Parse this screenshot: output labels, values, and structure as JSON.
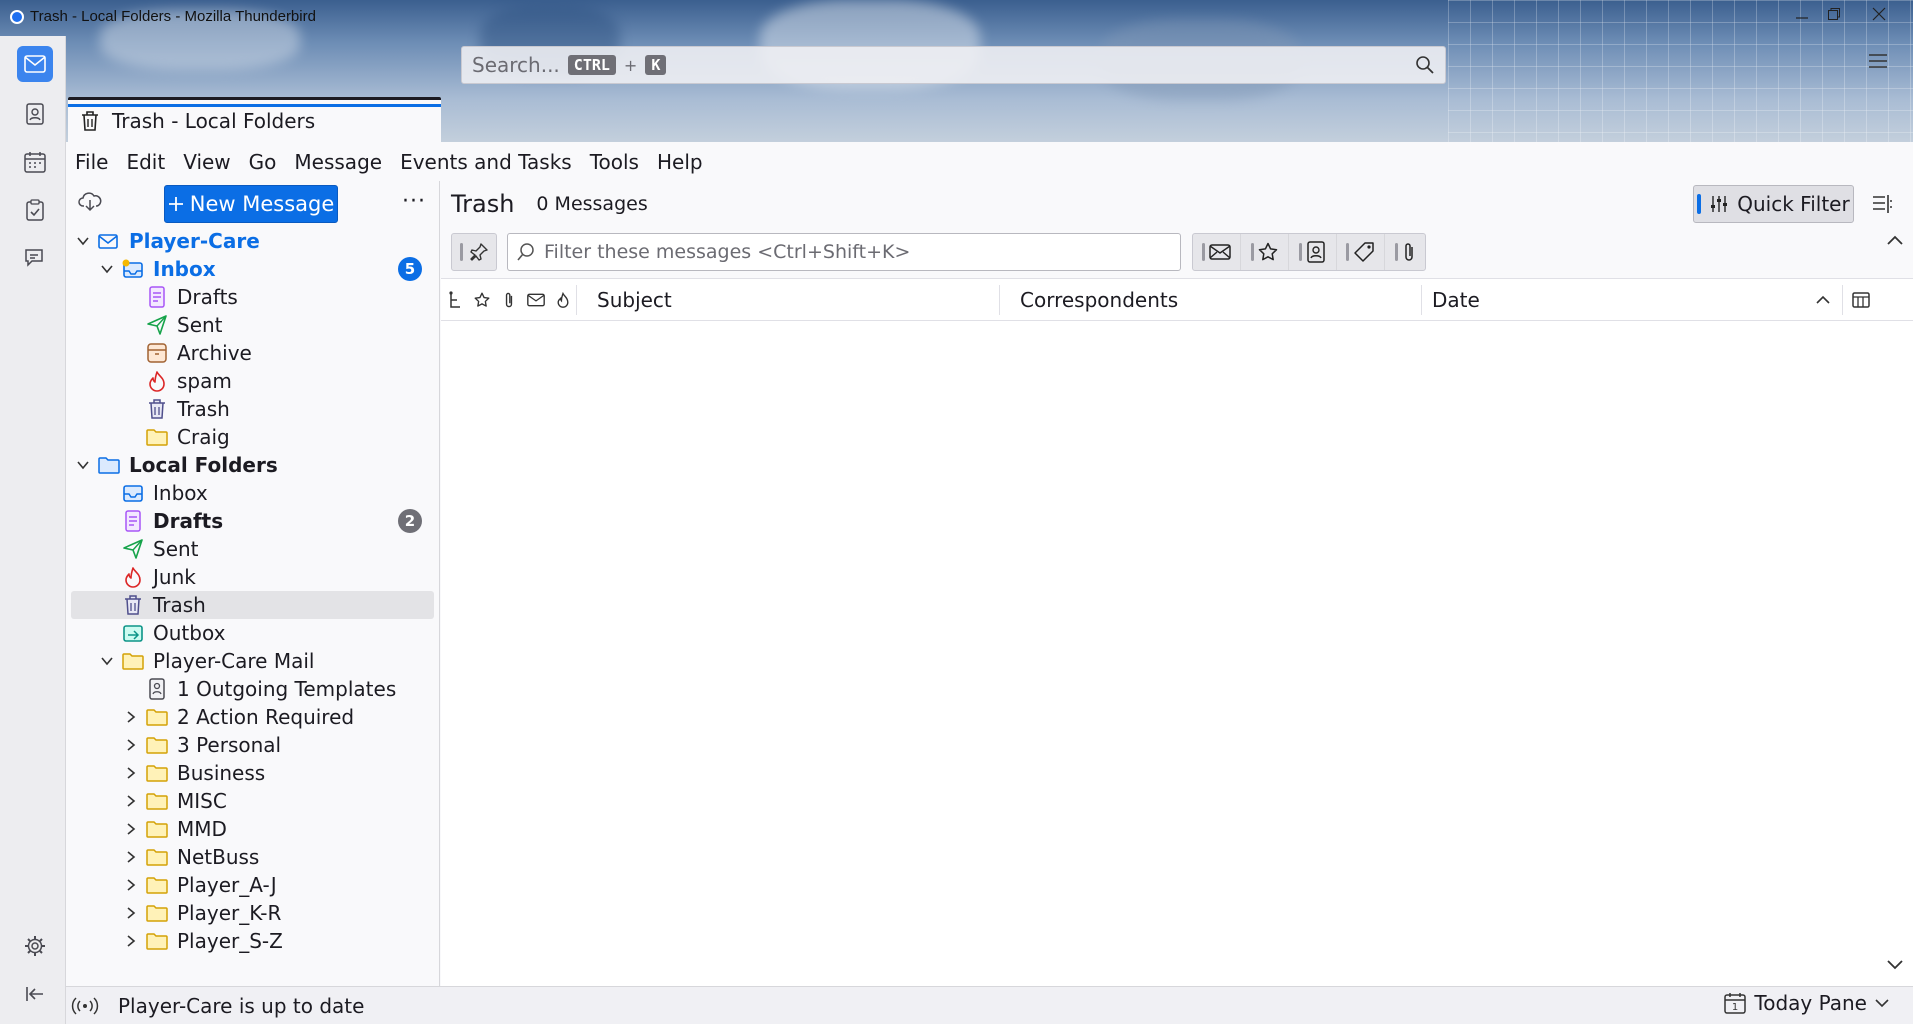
{
  "window": {
    "title": "Trash - Local Folders - Mozilla Thunderbird"
  },
  "search": {
    "placeholder": "Search...",
    "key1": "CTRL",
    "plus": "+",
    "key2": "K"
  },
  "tab": {
    "title": "Trash - Local Folders"
  },
  "menu": [
    "File",
    "Edit",
    "View",
    "Go",
    "Message",
    "Events and Tasks",
    "Tools",
    "Help"
  ],
  "folder_pane": {
    "new_message": "New Message",
    "more": "···"
  },
  "accounts": [
    {
      "name": "Player-Care",
      "folders": [
        {
          "name": "Inbox",
          "badge": "5"
        },
        {
          "name": "Drafts"
        },
        {
          "name": "Sent"
        },
        {
          "name": "Archive"
        },
        {
          "name": "spam"
        },
        {
          "name": "Trash"
        },
        {
          "name": "Craig"
        }
      ]
    },
    {
      "name": "Local Folders",
      "folders": [
        {
          "name": "Inbox"
        },
        {
          "name": "Drafts",
          "badge": "2"
        },
        {
          "name": "Sent"
        },
        {
          "name": "Junk"
        },
        {
          "name": "Trash"
        },
        {
          "name": "Outbox"
        },
        {
          "name": "Player-Care Mail",
          "children": [
            "1 Outgoing Templates",
            "2 Action Required",
            "3 Personal",
            "Business",
            "MISC",
            "MMD",
            "NetBuss",
            "Player_A-J",
            "Player_K-R",
            "Player_S-Z"
          ]
        }
      ]
    }
  ],
  "message_list": {
    "folder": "Trash",
    "count": "0 Messages",
    "quick_filter": "Quick Filter",
    "filter_placeholder": "Filter these messages <Ctrl+Shift+K>",
    "columns": {
      "subject": "Subject",
      "correspondents": "Correspondents",
      "date": "Date"
    }
  },
  "status": {
    "text": "Player-Care is up to date",
    "today_pane": "Today Pane",
    "today_day": "1"
  },
  "colors": {
    "accent": "#0b6ee5",
    "badge_blue": "#0b6ee5",
    "badge_gray": "#6f6f76"
  }
}
